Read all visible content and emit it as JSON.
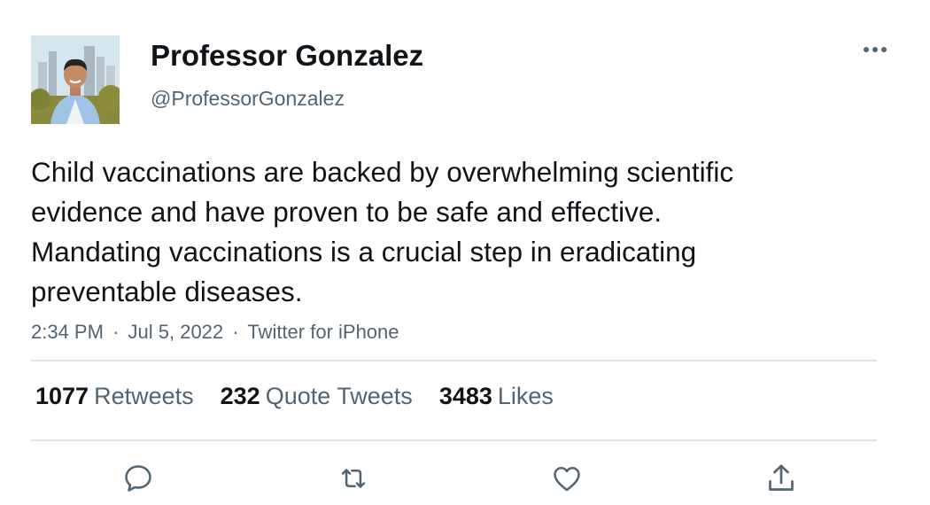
{
  "author": {
    "display_name": "Professor Gonzalez",
    "handle": "@ProfessorGonzalez"
  },
  "tweet": {
    "text": "Child vaccinations are backed by overwhelming scientific evidence and have proven to be safe and effective. Mandating vaccinations is a crucial step in eradicating preventable diseases.",
    "time": "2:34 PM",
    "separator": "·",
    "date": "Jul 5, 2022",
    "source": "Twitter for iPhone"
  },
  "stats": {
    "retweets_count": "1077",
    "retweets_label": "Retweets",
    "quotes_count": "232",
    "quotes_label": "Quote Tweets",
    "likes_count": "3483",
    "likes_label": "Likes"
  },
  "icons": {
    "more": "more-horizontal-icon",
    "reply": "reply-icon",
    "retweet": "retweet-icon",
    "like": "heart-icon",
    "share": "share-icon"
  },
  "colors": {
    "text": "#0f1419",
    "secondary": "#536471",
    "divider": "#dfe3e6",
    "background": "#ffffff"
  }
}
